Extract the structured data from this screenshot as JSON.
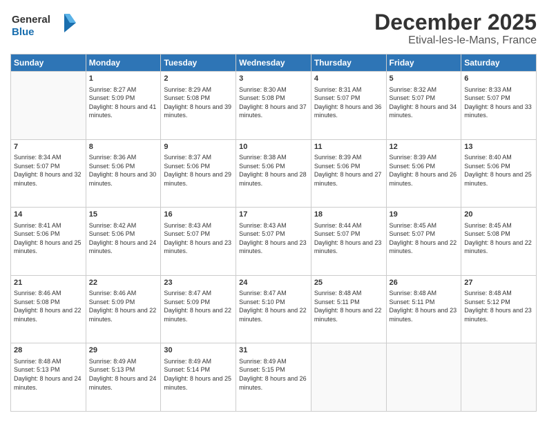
{
  "logo": {
    "line1": "General",
    "line2": "Blue"
  },
  "header": {
    "month": "December 2025",
    "location": "Etival-les-le-Mans, France"
  },
  "weekdays": [
    "Sunday",
    "Monday",
    "Tuesday",
    "Wednesday",
    "Thursday",
    "Friday",
    "Saturday"
  ],
  "weeks": [
    [
      {
        "day": "",
        "empty": true
      },
      {
        "day": "1",
        "sunrise": "8:27 AM",
        "sunset": "5:09 PM",
        "daylight": "8 hours and 41 minutes."
      },
      {
        "day": "2",
        "sunrise": "8:29 AM",
        "sunset": "5:08 PM",
        "daylight": "8 hours and 39 minutes."
      },
      {
        "day": "3",
        "sunrise": "8:30 AM",
        "sunset": "5:08 PM",
        "daylight": "8 hours and 37 minutes."
      },
      {
        "day": "4",
        "sunrise": "8:31 AM",
        "sunset": "5:07 PM",
        "daylight": "8 hours and 36 minutes."
      },
      {
        "day": "5",
        "sunrise": "8:32 AM",
        "sunset": "5:07 PM",
        "daylight": "8 hours and 34 minutes."
      },
      {
        "day": "6",
        "sunrise": "8:33 AM",
        "sunset": "5:07 PM",
        "daylight": "8 hours and 33 minutes."
      }
    ],
    [
      {
        "day": "7",
        "sunrise": "8:34 AM",
        "sunset": "5:07 PM",
        "daylight": "8 hours and 32 minutes."
      },
      {
        "day": "8",
        "sunrise": "8:36 AM",
        "sunset": "5:06 PM",
        "daylight": "8 hours and 30 minutes."
      },
      {
        "day": "9",
        "sunrise": "8:37 AM",
        "sunset": "5:06 PM",
        "daylight": "8 hours and 29 minutes."
      },
      {
        "day": "10",
        "sunrise": "8:38 AM",
        "sunset": "5:06 PM",
        "daylight": "8 hours and 28 minutes."
      },
      {
        "day": "11",
        "sunrise": "8:39 AM",
        "sunset": "5:06 PM",
        "daylight": "8 hours and 27 minutes."
      },
      {
        "day": "12",
        "sunrise": "8:39 AM",
        "sunset": "5:06 PM",
        "daylight": "8 hours and 26 minutes."
      },
      {
        "day": "13",
        "sunrise": "8:40 AM",
        "sunset": "5:06 PM",
        "daylight": "8 hours and 25 minutes."
      }
    ],
    [
      {
        "day": "14",
        "sunrise": "8:41 AM",
        "sunset": "5:06 PM",
        "daylight": "8 hours and 25 minutes."
      },
      {
        "day": "15",
        "sunrise": "8:42 AM",
        "sunset": "5:06 PM",
        "daylight": "8 hours and 24 minutes."
      },
      {
        "day": "16",
        "sunrise": "8:43 AM",
        "sunset": "5:07 PM",
        "daylight": "8 hours and 23 minutes."
      },
      {
        "day": "17",
        "sunrise": "8:43 AM",
        "sunset": "5:07 PM",
        "daylight": "8 hours and 23 minutes."
      },
      {
        "day": "18",
        "sunrise": "8:44 AM",
        "sunset": "5:07 PM",
        "daylight": "8 hours and 23 minutes."
      },
      {
        "day": "19",
        "sunrise": "8:45 AM",
        "sunset": "5:07 PM",
        "daylight": "8 hours and 22 minutes."
      },
      {
        "day": "20",
        "sunrise": "8:45 AM",
        "sunset": "5:08 PM",
        "daylight": "8 hours and 22 minutes."
      }
    ],
    [
      {
        "day": "21",
        "sunrise": "8:46 AM",
        "sunset": "5:08 PM",
        "daylight": "8 hours and 22 minutes."
      },
      {
        "day": "22",
        "sunrise": "8:46 AM",
        "sunset": "5:09 PM",
        "daylight": "8 hours and 22 minutes."
      },
      {
        "day": "23",
        "sunrise": "8:47 AM",
        "sunset": "5:09 PM",
        "daylight": "8 hours and 22 minutes."
      },
      {
        "day": "24",
        "sunrise": "8:47 AM",
        "sunset": "5:10 PM",
        "daylight": "8 hours and 22 minutes."
      },
      {
        "day": "25",
        "sunrise": "8:48 AM",
        "sunset": "5:11 PM",
        "daylight": "8 hours and 22 minutes."
      },
      {
        "day": "26",
        "sunrise": "8:48 AM",
        "sunset": "5:11 PM",
        "daylight": "8 hours and 23 minutes."
      },
      {
        "day": "27",
        "sunrise": "8:48 AM",
        "sunset": "5:12 PM",
        "daylight": "8 hours and 23 minutes."
      }
    ],
    [
      {
        "day": "28",
        "sunrise": "8:48 AM",
        "sunset": "5:13 PM",
        "daylight": "8 hours and 24 minutes."
      },
      {
        "day": "29",
        "sunrise": "8:49 AM",
        "sunset": "5:13 PM",
        "daylight": "8 hours and 24 minutes."
      },
      {
        "day": "30",
        "sunrise": "8:49 AM",
        "sunset": "5:14 PM",
        "daylight": "8 hours and 25 minutes."
      },
      {
        "day": "31",
        "sunrise": "8:49 AM",
        "sunset": "5:15 PM",
        "daylight": "8 hours and 26 minutes."
      },
      {
        "day": "",
        "empty": true
      },
      {
        "day": "",
        "empty": true
      },
      {
        "day": "",
        "empty": true
      }
    ]
  ]
}
